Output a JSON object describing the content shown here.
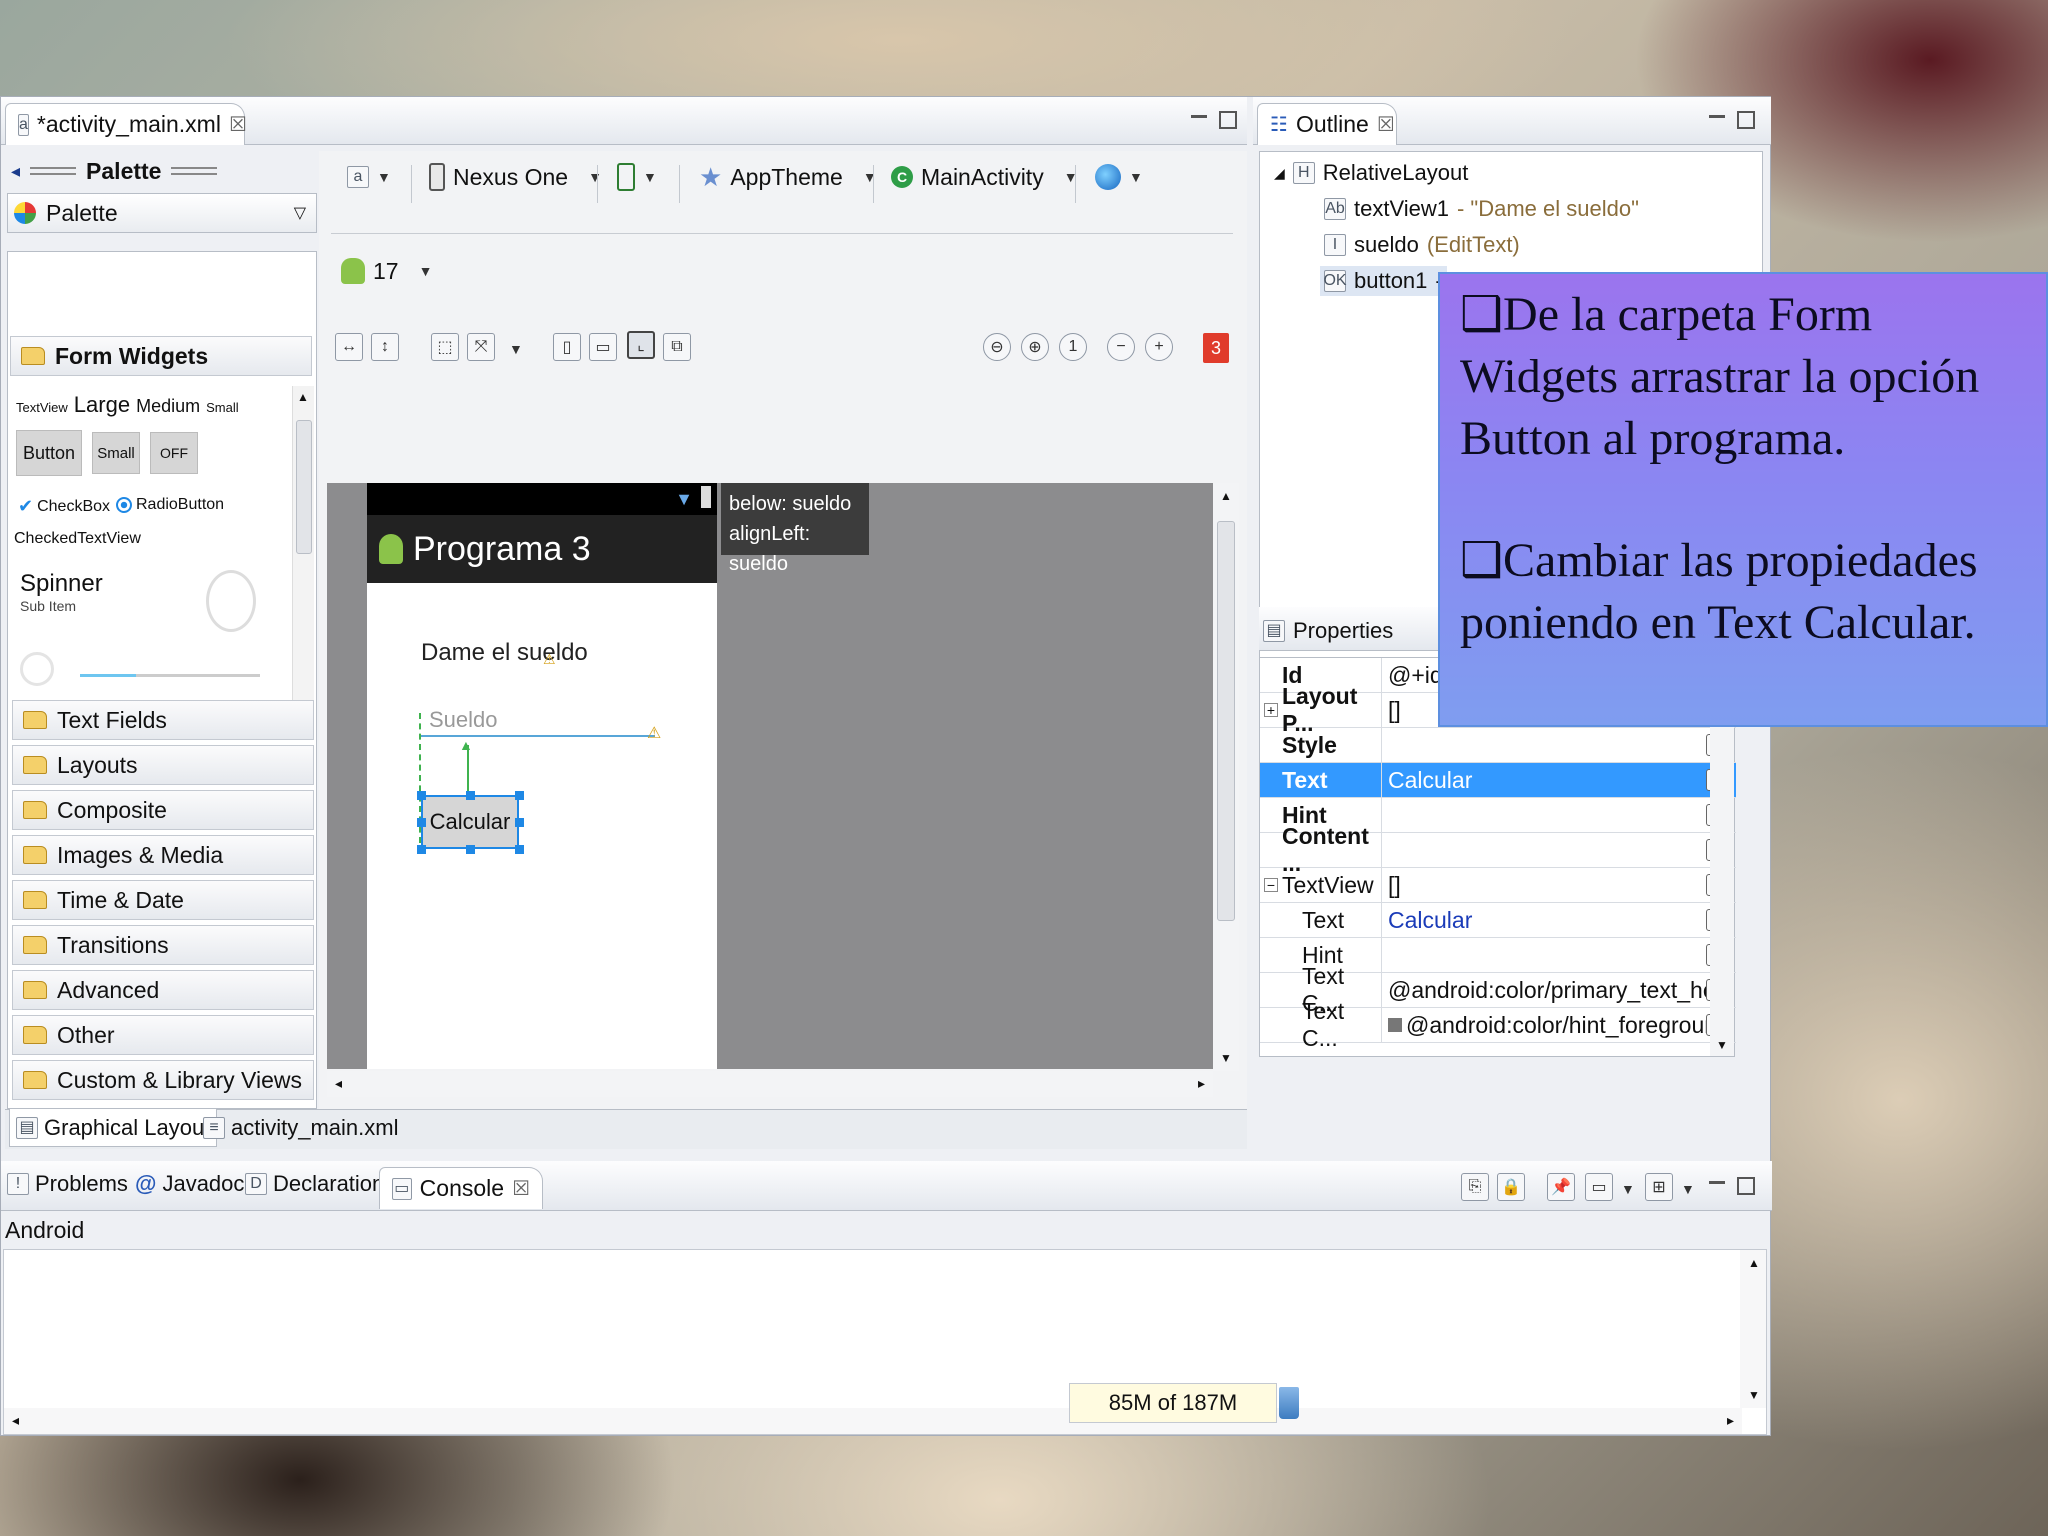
{
  "editor": {
    "tab_title": "*activity_main.xml",
    "palette_header": "Palette",
    "palette_dropdown": "Palette",
    "folders": [
      "Form Widgets",
      "Text Fields",
      "Layouts",
      "Composite",
      "Images & Media",
      "Time & Date",
      "Transitions",
      "Advanced",
      "Other",
      "Custom & Library Views"
    ],
    "widgets": {
      "textview_small": "TextView",
      "large": "Large",
      "medium": "Medium",
      "small": "Small",
      "button": "Button",
      "small_btn": "Small",
      "off": "OFF",
      "checkbox": "CheckBox",
      "radiobutton": "RadioButton",
      "checkedtextview": "CheckedTextView",
      "spinner": "Spinner",
      "subitem": "Sub Item"
    },
    "toolbar": {
      "device": "Nexus One",
      "theme": "AppTheme",
      "activity": "MainActivity",
      "api": "17",
      "error_count": "3"
    },
    "preview": {
      "app_title": "Programa 3",
      "label": "Dame el sueldo",
      "hint": "Sueldo",
      "button": "Calcular",
      "tooltip_line1": "below: sueldo",
      "tooltip_line2": "alignLeft: sueldo"
    },
    "bottom_tabs": [
      "Graphical Layout",
      "activity_main.xml"
    ]
  },
  "outline": {
    "title": "Outline",
    "root": "RelativeLayout",
    "items": [
      {
        "name": "textView1",
        "detail": " - \"Dame el sueldo\""
      },
      {
        "name": "sueldo",
        "detail": " (EditText)"
      },
      {
        "name": "button1",
        "detail": " -"
      }
    ]
  },
  "properties": {
    "title": "Properties",
    "rows": [
      {
        "name": "Id",
        "value": "@+id/",
        "bold": true
      },
      {
        "name": "Layout P...",
        "value": "[]",
        "bold": true,
        "expand": "+"
      },
      {
        "name": "Style",
        "value": "",
        "bold": true
      },
      {
        "name": "Text",
        "value": "Calcular",
        "bold": true,
        "selected": true
      },
      {
        "name": "Hint",
        "value": "",
        "bold": true
      },
      {
        "name": "Content ...",
        "value": "",
        "bold": true
      },
      {
        "name": "TextView",
        "value": "[]",
        "bold": false,
        "expand": "−"
      },
      {
        "name": "Text",
        "value": "Calcular",
        "bold": false,
        "indent": true,
        "blue": true
      },
      {
        "name": "Hint",
        "value": "",
        "bold": false,
        "indent": true
      },
      {
        "name": "Text C...",
        "value": "@android:color/primary_text_holo_...",
        "bold": false,
        "indent": true
      },
      {
        "name": "Text C...",
        "value": "@android:color/hint_foreground...",
        "bold": false,
        "indent": true,
        "swatch": true
      }
    ]
  },
  "console": {
    "tabs": [
      "Problems",
      "Javadoc",
      "Declaration",
      "Console"
    ],
    "label": "Android",
    "memory": "85M of 187M"
  },
  "note": {
    "paragraph1": "❑De la carpeta Form Widgets arrastrar la opción Button al programa.",
    "paragraph2": "❑Cambiar las propiedades poniendo en Text Calcular."
  },
  "colors": {
    "selection": "#3399ff",
    "link_blue": "#1a3bb8",
    "error_red": "#e03b2b"
  }
}
